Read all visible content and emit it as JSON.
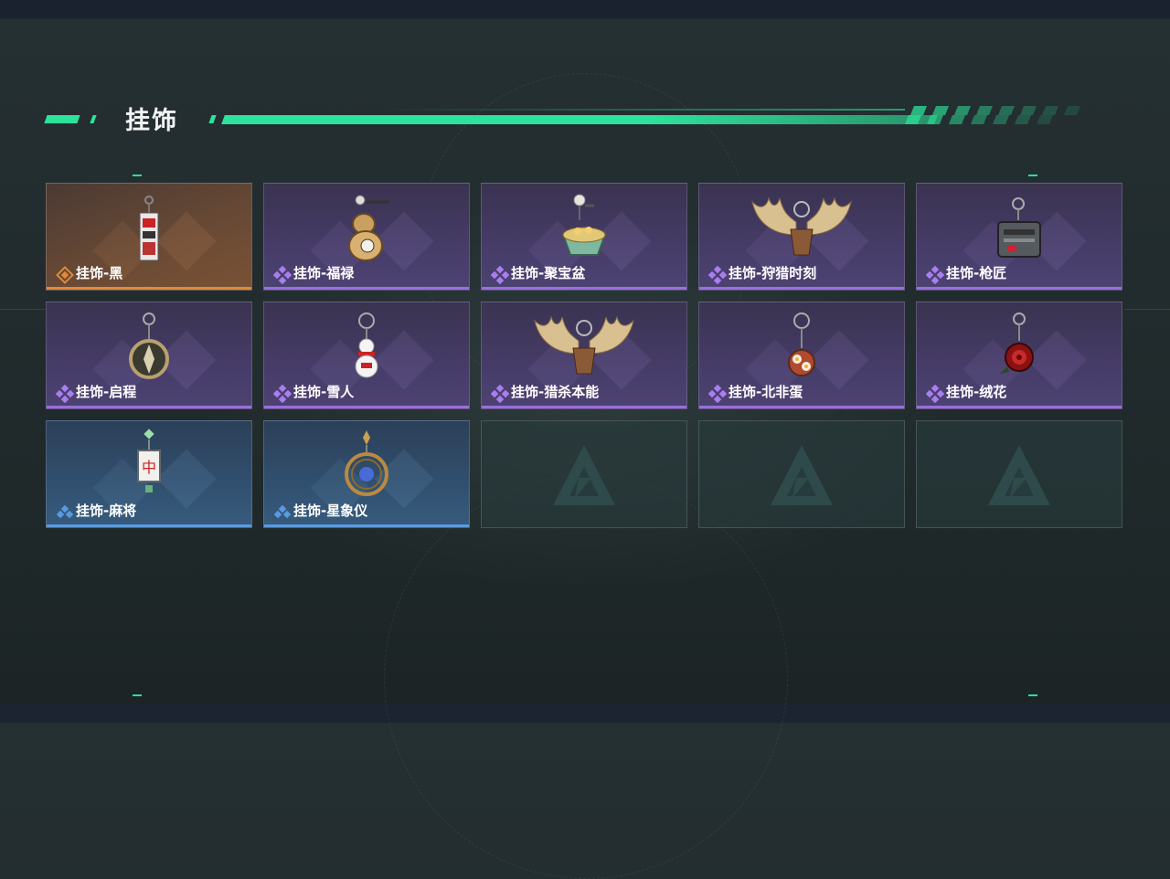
{
  "section": {
    "title": "挂饰"
  },
  "colors": {
    "accent_green": "#2de29a",
    "rarity_purple": "#9b6ee0",
    "rarity_orange": "#e08a3c",
    "rarity_blue": "#5a9ae0"
  },
  "items": [
    {
      "label": "挂饰-黑",
      "rarity": "orange",
      "icon": "black-charm-icon"
    },
    {
      "label": "挂饰-福禄",
      "rarity": "purple",
      "icon": "gourd-charm-icon"
    },
    {
      "label": "挂饰-聚宝盆",
      "rarity": "purple",
      "icon": "treasure-bowl-charm-icon"
    },
    {
      "label": "挂饰-狩猎时刻",
      "rarity": "purple",
      "icon": "antler-charm-icon"
    },
    {
      "label": "挂饰-枪匠",
      "rarity": "purple",
      "icon": "gunsmith-charm-icon"
    },
    {
      "label": "挂饰-启程",
      "rarity": "purple",
      "icon": "compass-charm-icon"
    },
    {
      "label": "挂饰-雪人",
      "rarity": "purple",
      "icon": "snowman-charm-icon"
    },
    {
      "label": "挂饰-猎杀本能",
      "rarity": "purple",
      "icon": "antler-charm-icon"
    },
    {
      "label": "挂饰-北非蛋",
      "rarity": "purple",
      "icon": "shakshuka-charm-icon"
    },
    {
      "label": "挂饰-绒花",
      "rarity": "purple",
      "icon": "velvet-flower-charm-icon"
    },
    {
      "label": "挂饰-麻将",
      "rarity": "blue",
      "icon": "mahjong-charm-icon"
    },
    {
      "label": "挂饰-星象仪",
      "rarity": "blue",
      "icon": "astrolabe-charm-icon"
    }
  ],
  "empty_slots": 3
}
